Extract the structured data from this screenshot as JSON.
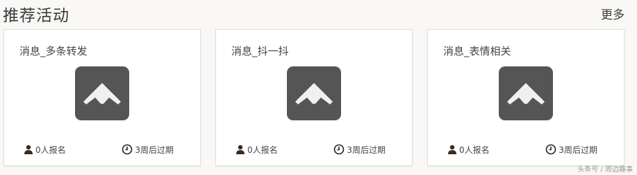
{
  "header": {
    "title": "推荐活动",
    "more_label": "更多"
  },
  "cards": [
    {
      "title": "消息_多条转发",
      "signup": "0人报名",
      "expiry": "3周后过期"
    },
    {
      "title": "消息_抖一抖",
      "signup": "0人报名",
      "expiry": "3周后过期"
    },
    {
      "title": "消息_表情相关",
      "signup": "0人报名",
      "expiry": "3周后过期"
    }
  ],
  "icons": {
    "logo": "mountain-logo-icon",
    "signup": "person-icon",
    "expiry": "clock-icon"
  },
  "colors": {
    "background": "#f9f8f6",
    "card": "#ffffff",
    "logo_bg": "#555555",
    "text": "#333333"
  },
  "watermark": "头条号 / 周边趣事"
}
